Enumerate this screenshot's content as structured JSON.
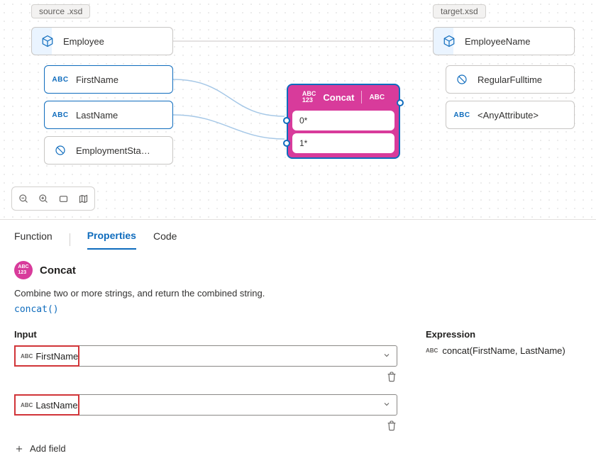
{
  "source": {
    "file": "source .xsd",
    "root": "Employee",
    "fields": [
      {
        "name": "FirstName",
        "icon": "abc"
      },
      {
        "name": "LastName",
        "icon": "abc"
      },
      {
        "name": "EmploymentSta…",
        "icon": "forbidden"
      }
    ]
  },
  "target": {
    "file": "target.xsd",
    "root": "EmployeeName",
    "fields": [
      {
        "name": "RegularFulltime",
        "icon": "forbidden"
      },
      {
        "name": "<AnyAttribute>",
        "icon": "abc"
      }
    ]
  },
  "concat_node": {
    "title": "Concat",
    "ports": [
      "0*",
      "1*"
    ]
  },
  "tabs": {
    "function": "Function",
    "properties": "Properties",
    "code": "Code"
  },
  "panel": {
    "name": "Concat",
    "description": "Combine two or more strings, and return the combined string.",
    "signature": "concat()",
    "input_label": "Input",
    "inputs": [
      "FirstName",
      "LastName"
    ],
    "add_field": "Add field",
    "expression_label": "Expression",
    "expression": "concat(FirstName, LastName)"
  }
}
